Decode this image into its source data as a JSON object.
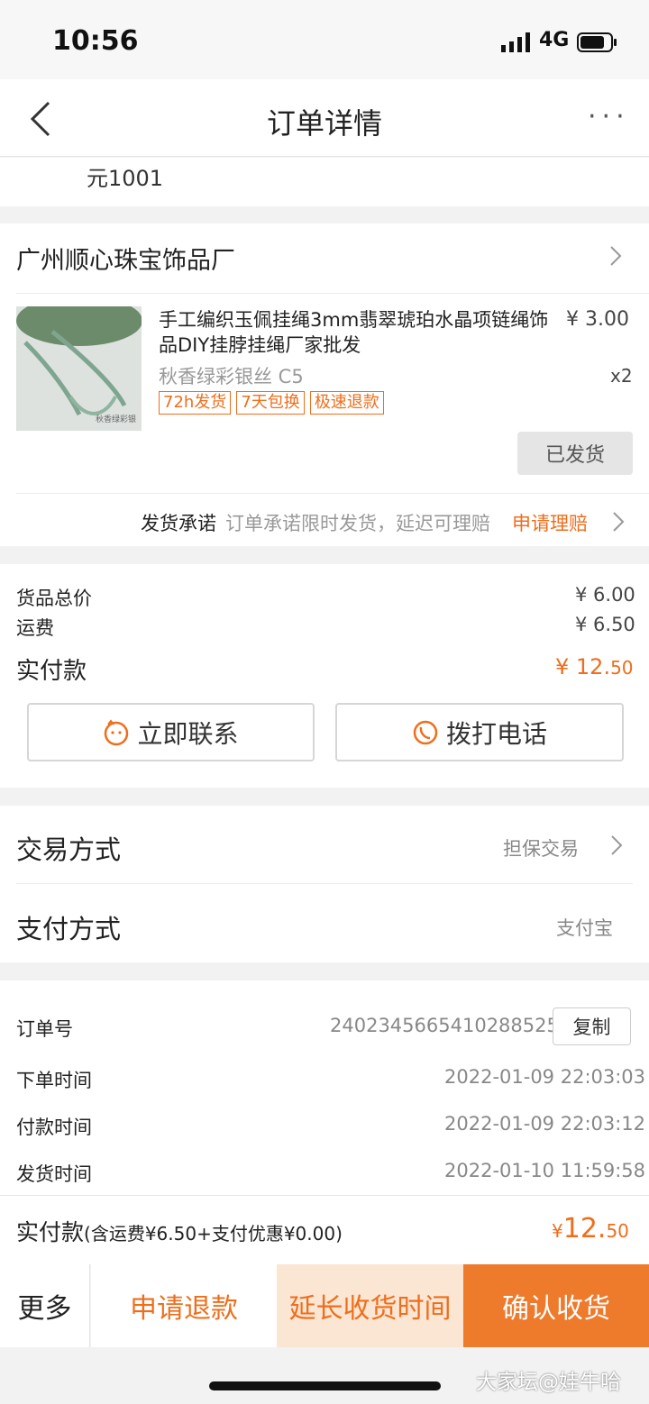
{
  "status": {
    "time": "10:56",
    "network": "4G"
  },
  "nav": {
    "title": "订单详情",
    "more": "···"
  },
  "top_snippet": "元1001",
  "shop": {
    "name": "广州顺心珠宝饰品厂"
  },
  "item": {
    "title": "手工编织玉佩挂绳3mm翡翠琥珀水晶项链绳饰品DIY挂脖挂绳厂家批发",
    "price": "¥ 3.00",
    "sku": "秋香绿彩银丝 C5",
    "qty": "x2",
    "tags": [
      "72h发货",
      "7天包换",
      "极速退款"
    ],
    "image_caption": "秋香绿彩银",
    "status_button": "已发货"
  },
  "promise": {
    "label": "发货承诺",
    "text": "订单承诺限时发货，延迟可理赔",
    "action": "申请理赔"
  },
  "amounts": {
    "goods_label": "货品总价",
    "goods_value": "¥ 6.00",
    "shipping_label": "运费",
    "shipping_value": "¥ 6.50",
    "paid_label": "实付款",
    "paid_currency": "¥ 12.",
    "paid_cents": "50"
  },
  "contact": {
    "chat_label": "立即联系",
    "call_label": "拨打电话"
  },
  "trade": {
    "method_label": "交易方式",
    "method_value": "担保交易",
    "pay_label": "支付方式",
    "pay_value": "支付宝"
  },
  "order": {
    "id_label": "订单号",
    "id_value": "2402345665410288525",
    "copy_label": "复制",
    "placed_label": "下单时间",
    "placed_value": "2022-01-09 22:03:03",
    "paid_label": "付款时间",
    "paid_value": "2022-01-09 22:03:12",
    "shipped_label": "发货时间",
    "shipped_value": "2022-01-10 11:59:58"
  },
  "summary": {
    "label": "实付款",
    "detail": "(含运费¥6.50+支付优惠¥0.00)",
    "currency": "¥",
    "amount": "12.",
    "cents": "50"
  },
  "actions": {
    "more": "更多",
    "refund": "申请退款",
    "extend": "延长收货时间",
    "confirm": "确认收货"
  },
  "watermark": "大家坛@娃牛哈",
  "colors": {
    "accent": "#ee6e1c",
    "extend_bg": "#fbe5d3",
    "confirm_bg": "#ee7a2c"
  }
}
